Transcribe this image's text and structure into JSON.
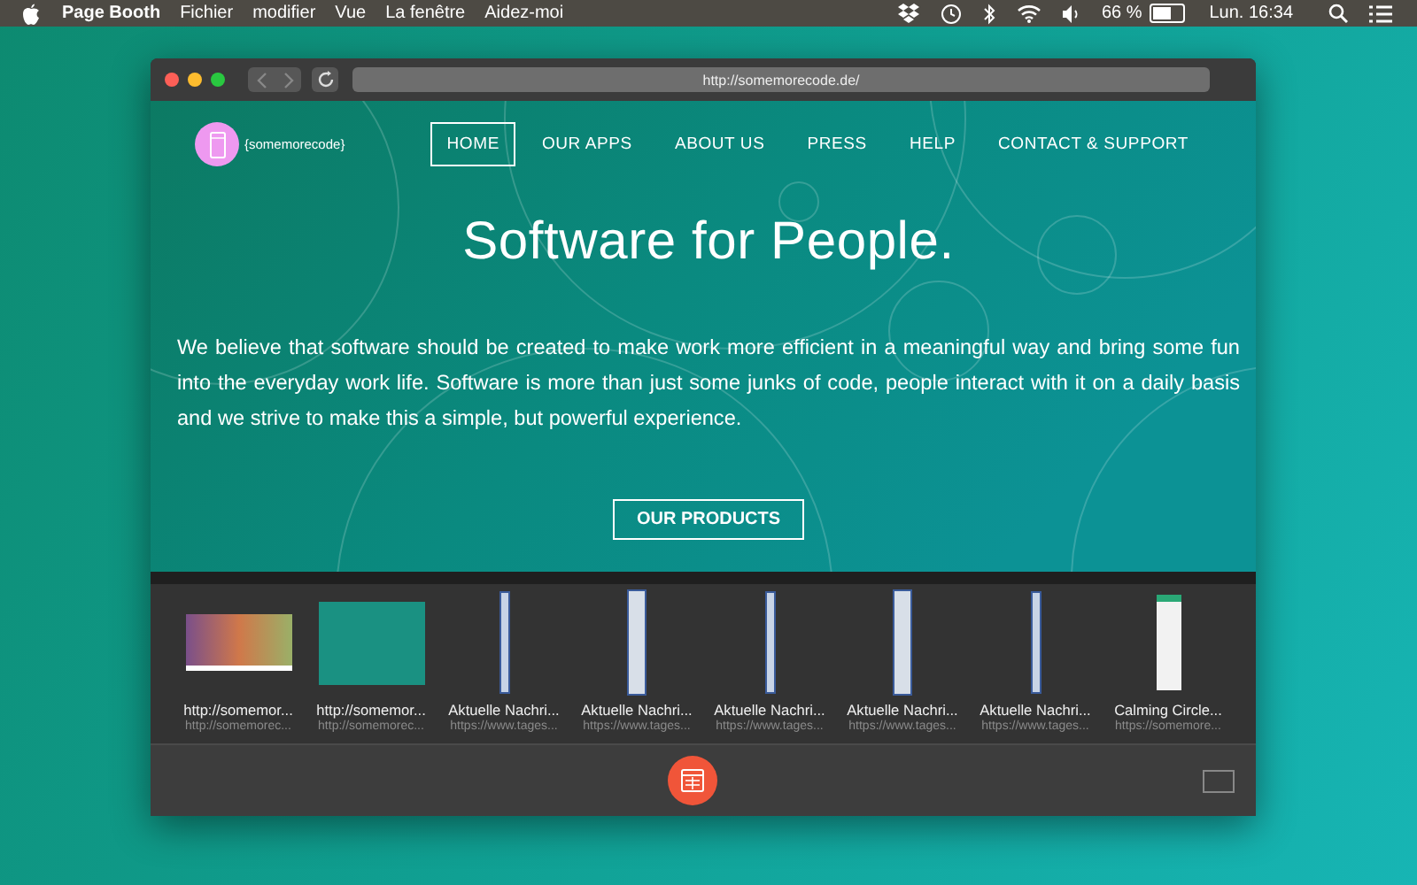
{
  "menu_bar": {
    "app_name": "Page Booth",
    "menus": [
      "Fichier",
      "modifier",
      "Vue",
      "La fenêtre",
      "Aidez-moi"
    ],
    "battery_percent": "66 %",
    "clock": "Lun. 16:34"
  },
  "browser": {
    "url": "http://somemorecode.de/"
  },
  "page": {
    "logo_text": "{somemorecode}",
    "nav": [
      {
        "label": "HOME",
        "selected": true
      },
      {
        "label": "OUR APPS",
        "selected": false
      },
      {
        "label": "ABOUT US",
        "selected": false
      },
      {
        "label": "PRESS",
        "selected": false
      },
      {
        "label": "HELP",
        "selected": false
      },
      {
        "label": "CONTACT & SUPPORT",
        "selected": false
      }
    ],
    "headline": "Software for People.",
    "intro": "We believe that software should be created to make work more efficient in a meaningful way and bring some fun into the everyday work life. Software is more than just some junks of code, people interact with it on a daily basis and we strive to make this a simple, but powerful experience.",
    "button": "OUR PRODUCTS"
  },
  "thumbnails": [
    {
      "kind": "photo",
      "title": "http://somemor...",
      "url": "http://somemorec..."
    },
    {
      "kind": "site",
      "title": "http://somemor...",
      "url": "http://somemorec..."
    },
    {
      "kind": "strip",
      "title": "Aktuelle Nachri...",
      "url": "https://www.tages..."
    },
    {
      "kind": "column",
      "title": "Aktuelle Nachri...",
      "url": "https://www.tages..."
    },
    {
      "kind": "strip",
      "title": "Aktuelle Nachri...",
      "url": "https://www.tages..."
    },
    {
      "kind": "column",
      "title": "Aktuelle Nachri...",
      "url": "https://www.tages..."
    },
    {
      "kind": "strip",
      "title": "Aktuelle Nachri...",
      "url": "https://www.tages..."
    },
    {
      "kind": "phone",
      "title": "Calming Circle...",
      "url": "https://somemore..."
    }
  ]
}
